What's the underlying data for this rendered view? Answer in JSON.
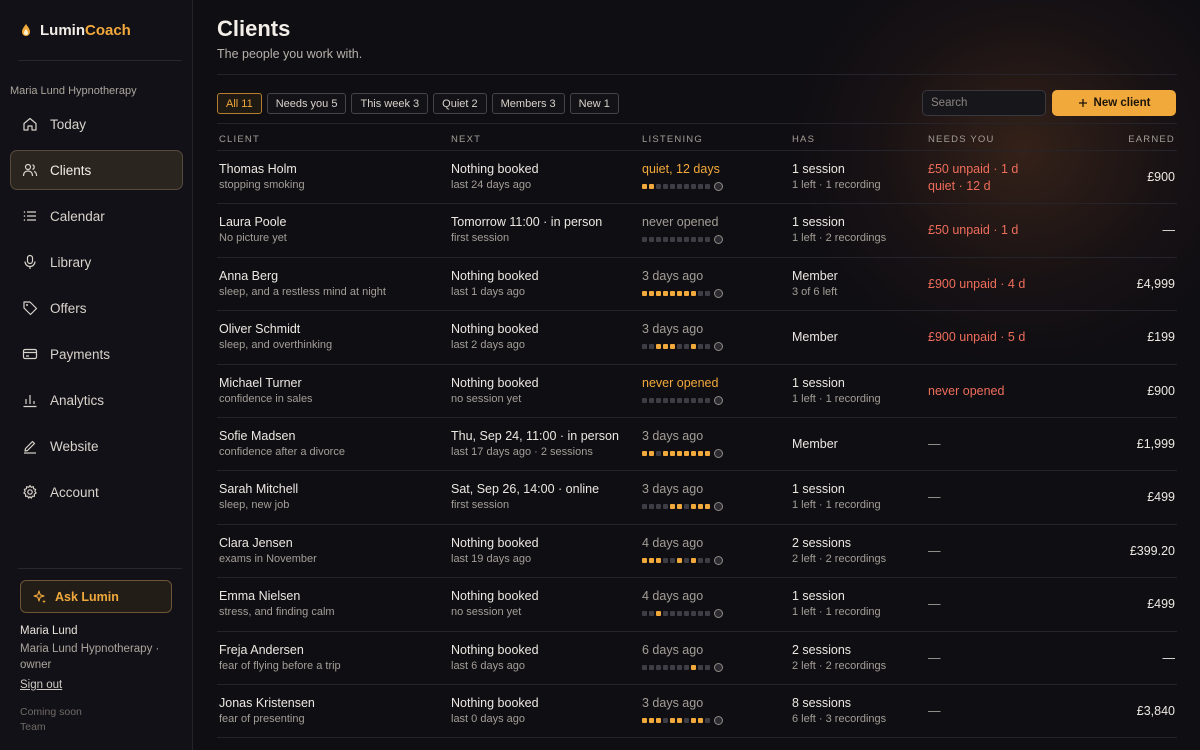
{
  "app": {
    "brand_a": "Lumin",
    "brand_b": "Coach",
    "workspace": "Maria Lund Hypnotherapy"
  },
  "colors": {
    "accent": "#f2a93b",
    "danger": "#ee6d5a",
    "background": "#0f0e13"
  },
  "nav": [
    {
      "label": "Today",
      "icon": "home-icon"
    },
    {
      "label": "Clients",
      "icon": "users-icon",
      "active": true
    },
    {
      "label": "Calendar",
      "icon": "list-icon"
    },
    {
      "label": "Library",
      "icon": "microphone-icon"
    },
    {
      "label": "Offers",
      "icon": "tag-icon"
    },
    {
      "label": "Payments",
      "icon": "card-icon"
    },
    {
      "label": "Analytics",
      "icon": "bar-chart-icon"
    },
    {
      "label": "Website",
      "icon": "edit-icon"
    },
    {
      "label": "Account",
      "icon": "gear-icon"
    }
  ],
  "sidebar_footer": {
    "ask_label": "Ask Lumin",
    "user_name": "Maria Lund",
    "user_role": "Maria Lund Hypnotherapy · owner",
    "sign_out": "Sign out",
    "coming_soon": "Coming soon",
    "team": "Team"
  },
  "page": {
    "title": "Clients",
    "subtitle": "The people you work with."
  },
  "filters": [
    {
      "label": "All 11",
      "active": true
    },
    {
      "label": "Needs you 5"
    },
    {
      "label": "This week 3"
    },
    {
      "label": "Quiet 2"
    },
    {
      "label": "Members 3"
    },
    {
      "label": "New 1"
    }
  ],
  "search": {
    "placeholder": "Search"
  },
  "new_client_label": "New client",
  "columns": [
    "CLIENT",
    "NEXT",
    "LISTENING",
    "HAS",
    "NEEDS YOU",
    "EARNED"
  ],
  "rows": [
    {
      "name": "Thomas Holm",
      "topic": "stopping smoking",
      "next": "Nothing booked",
      "next_sub": "last 24 days ago",
      "listening": "quiet, 12 days",
      "listening_tone": "amber",
      "dots": "1100000000",
      "has": "1 session",
      "has_sub": "1 left · 1 recording",
      "needs": "£50 unpaid · 1 d",
      "needs_sub": "quiet · 12 d",
      "needs_tone": "red",
      "earned": "£900"
    },
    {
      "name": "Laura Poole",
      "topic": "No picture yet",
      "next": "Tomorrow 11:00 · in person",
      "next_sub": "first session",
      "listening": "never opened",
      "listening_tone": "muted",
      "dots": "0000000000",
      "has": "1 session",
      "has_sub": "1 left · 2 recordings",
      "needs": "£50 unpaid · 1 d",
      "needs_sub": "",
      "needs_tone": "red",
      "earned": "—"
    },
    {
      "name": "Anna Berg",
      "topic": "sleep, and a restless mind at night",
      "next": "Nothing booked",
      "next_sub": "last 1 days ago",
      "listening": "3 days ago",
      "listening_tone": "muted",
      "dots": "1111111100",
      "has": "Member",
      "has_sub": "3 of 6 left",
      "needs": "£900 unpaid · 4 d",
      "needs_sub": "",
      "needs_tone": "red",
      "earned": "£4,999"
    },
    {
      "name": "Oliver Schmidt",
      "topic": "sleep, and overthinking",
      "next": "Nothing booked",
      "next_sub": "last 2 days ago",
      "listening": "3 days ago",
      "listening_tone": "muted",
      "dots": "0011100100",
      "has": "Member",
      "has_sub": "",
      "needs": "£900 unpaid · 5 d",
      "needs_sub": "",
      "needs_tone": "red",
      "earned": "£199"
    },
    {
      "name": "Michael Turner",
      "topic": "confidence in sales",
      "next": "Nothing booked",
      "next_sub": "no session yet",
      "listening": "never opened",
      "listening_tone": "amber",
      "dots": "0000000000",
      "has": "1 session",
      "has_sub": "1 left · 1 recording",
      "needs": "never opened",
      "needs_sub": "",
      "needs_tone": "red",
      "earned": "£900"
    },
    {
      "name": "Sofie Madsen",
      "topic": "confidence after a divorce",
      "next": "Thu, Sep 24, 11:00 · in person",
      "next_sub": "last 17 days ago · 2 sessions",
      "listening": "3 days ago",
      "listening_tone": "muted",
      "dots": "1101111111",
      "has": "Member",
      "has_sub": "",
      "needs": "—",
      "needs_sub": "",
      "needs_tone": "dash",
      "earned": "£1,999"
    },
    {
      "name": "Sarah Mitchell",
      "topic": "sleep, new job",
      "next": "Sat, Sep 26, 14:00 · online",
      "next_sub": "first session",
      "listening": "3 days ago",
      "listening_tone": "muted",
      "dots": "0000110111",
      "has": "1 session",
      "has_sub": "1 left · 1 recording",
      "needs": "—",
      "needs_sub": "",
      "needs_tone": "dash",
      "earned": "£499"
    },
    {
      "name": "Clara Jensen",
      "topic": "exams in November",
      "next": "Nothing booked",
      "next_sub": "last 19 days ago",
      "listening": "4 days ago",
      "listening_tone": "muted",
      "dots": "1110010100",
      "has": "2 sessions",
      "has_sub": "2 left · 2 recordings",
      "needs": "—",
      "needs_sub": "",
      "needs_tone": "dash",
      "earned": "£399.20"
    },
    {
      "name": "Emma Nielsen",
      "topic": "stress, and finding calm",
      "next": "Nothing booked",
      "next_sub": "no session yet",
      "listening": "4 days ago",
      "listening_tone": "muted",
      "dots": "0010000000",
      "has": "1 session",
      "has_sub": "1 left · 1 recording",
      "needs": "—",
      "needs_sub": "",
      "needs_tone": "dash",
      "earned": "£499"
    },
    {
      "name": "Freja Andersen",
      "topic": "fear of flying before a trip",
      "next": "Nothing booked",
      "next_sub": "last 6 days ago",
      "listening": "6 days ago",
      "listening_tone": "muted",
      "dots": "0000000100",
      "has": "2 sessions",
      "has_sub": "2 left · 2 recordings",
      "needs": "—",
      "needs_sub": "",
      "needs_tone": "dash",
      "earned": "—"
    },
    {
      "name": "Jonas Kristensen",
      "topic": "fear of presenting",
      "next": "Nothing booked",
      "next_sub": "last 0 days ago",
      "listening": "3 days ago",
      "listening_tone": "muted",
      "dots": "1110110110",
      "has": "8 sessions",
      "has_sub": "6 left · 3 recordings",
      "needs": "—",
      "needs_sub": "",
      "needs_tone": "dash",
      "earned": "£3,840"
    }
  ]
}
